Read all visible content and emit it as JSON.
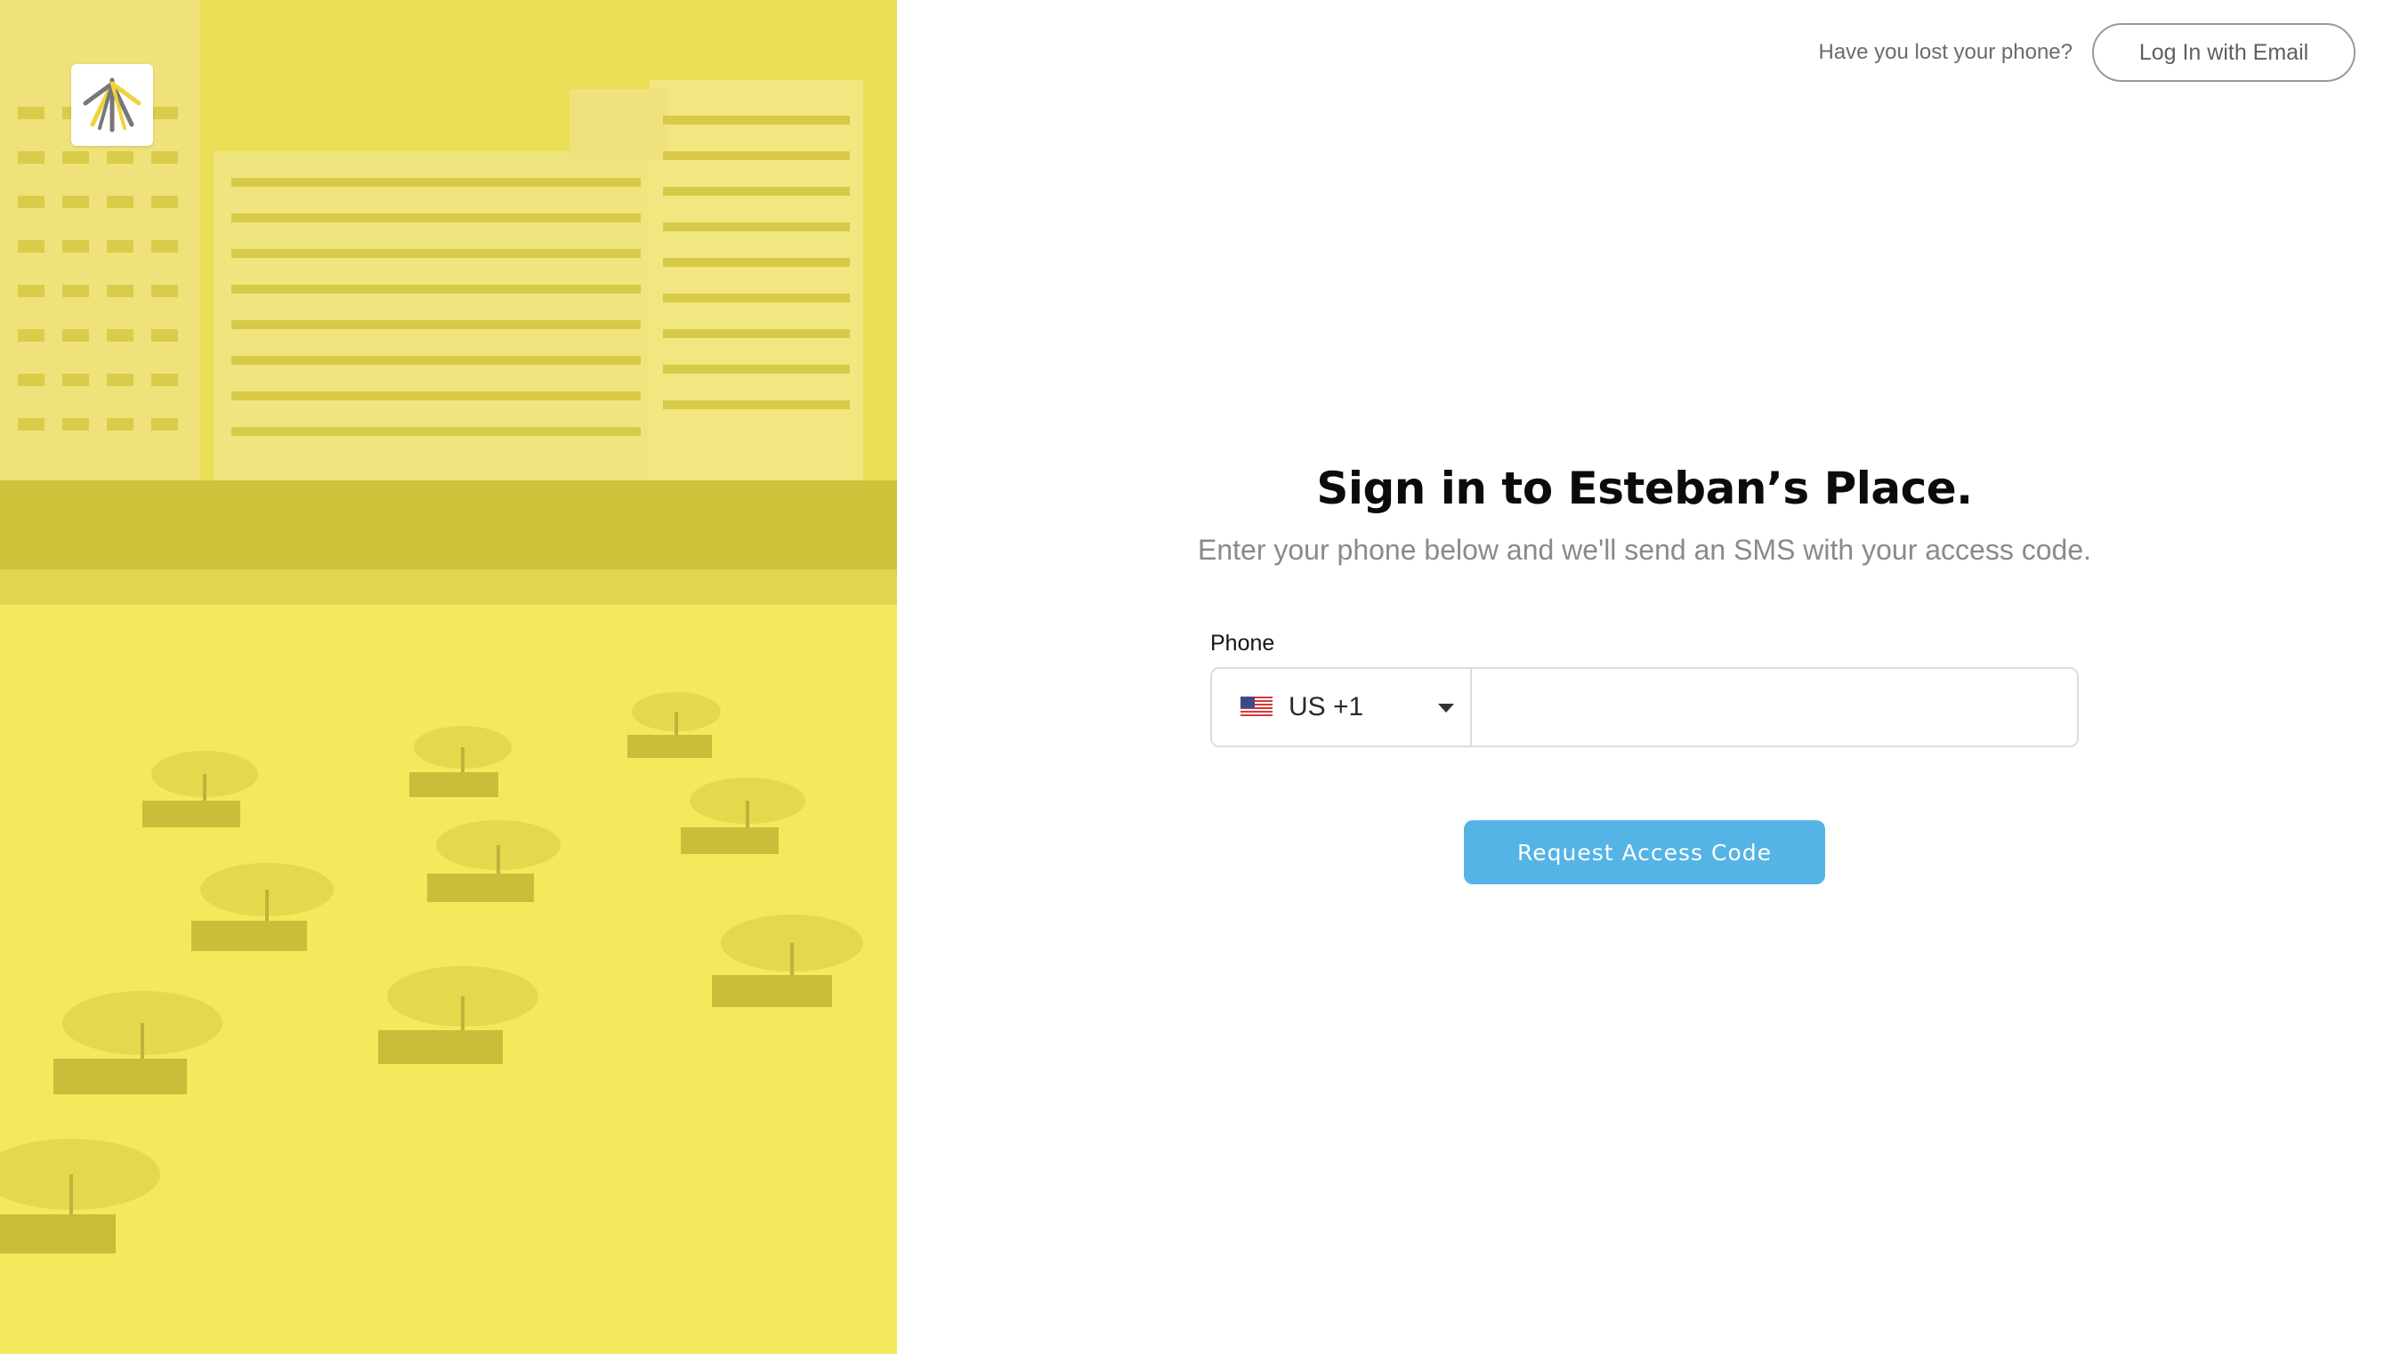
{
  "hero": {
    "logo_icon": "umbrella-logo-icon",
    "image_description_icon": "beach-hotel-photo",
    "tint_color": "#f3e75a"
  },
  "topbar": {
    "lost_phone_text": "Have you lost your phone?",
    "email_login_label": "Log In with Email"
  },
  "form": {
    "title": "Sign in to Esteban’s Place.",
    "subtitle": "Enter your phone below and we'll send an SMS with your access code.",
    "phone_label": "Phone",
    "country_code": "US +1",
    "country_flag_icon": "us-flag-icon",
    "phone_value": "",
    "phone_placeholder": "",
    "submit_label": "Request Access Code",
    "accent_color": "#54b4e6"
  }
}
